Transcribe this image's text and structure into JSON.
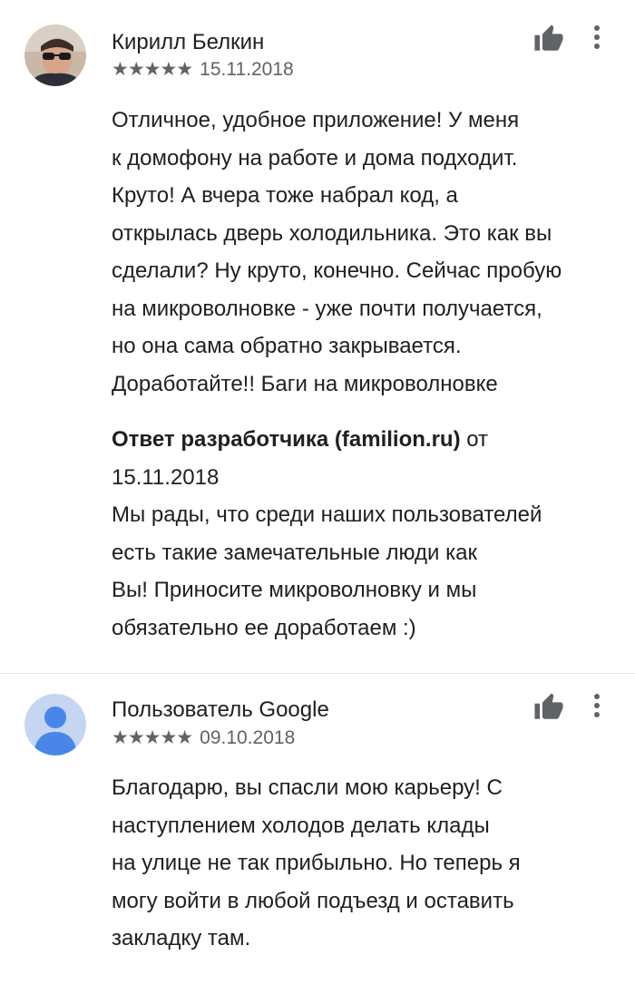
{
  "reviews": [
    {
      "author": "Кирилл Белкин",
      "stars": "★★★★★",
      "date": "15.11.2018",
      "avatar_icon": "user-photo-avatar",
      "text_lines": [
        "Отличное, удобное приложение! У меня",
        "к домофону на работе и дома подходит.",
        "Круто! А вчера тоже набрал код, а",
        "открылась дверь холодильника. Это как вы",
        "сделали? Ну круто, конечно. Сейчас пробую",
        "на микроволновке - уже почти получается,",
        "но она сама обратно закрывается.",
        "Доработайте!! Баги на микроволновке"
      ],
      "developer_reply": {
        "heading": "Ответ разработчика (familion.ru)",
        "from_word": " от",
        "date": "15.11.2018",
        "lines": [
          "Мы рады, что среди наших пользователей",
          "есть такие замечательные люди как",
          "Вы! Приносите микроволновку и мы",
          "обязательно ее доработаем :)"
        ]
      }
    },
    {
      "author": "Пользователь Google",
      "stars": "★★★★★",
      "date": "09.10.2018",
      "avatar_icon": "default-user-avatar",
      "text_lines": [
        "Благодарю, вы спасли мою карьеру! С",
        "наступлением холодов делать клады",
        "на улице не так прибыльно. Но теперь я",
        "могу войти в любой подъезд и оставить",
        "закладку там."
      ]
    }
  ],
  "icons": {
    "like": "thumbs-up-icon",
    "more": "more-vertical-icon"
  },
  "colors": {
    "text": "#202020",
    "meta": "#5f6368",
    "icon": "#5f6368",
    "default_avatar_bg": "#c5d5f2",
    "default_avatar_fg": "#4a86e8"
  }
}
